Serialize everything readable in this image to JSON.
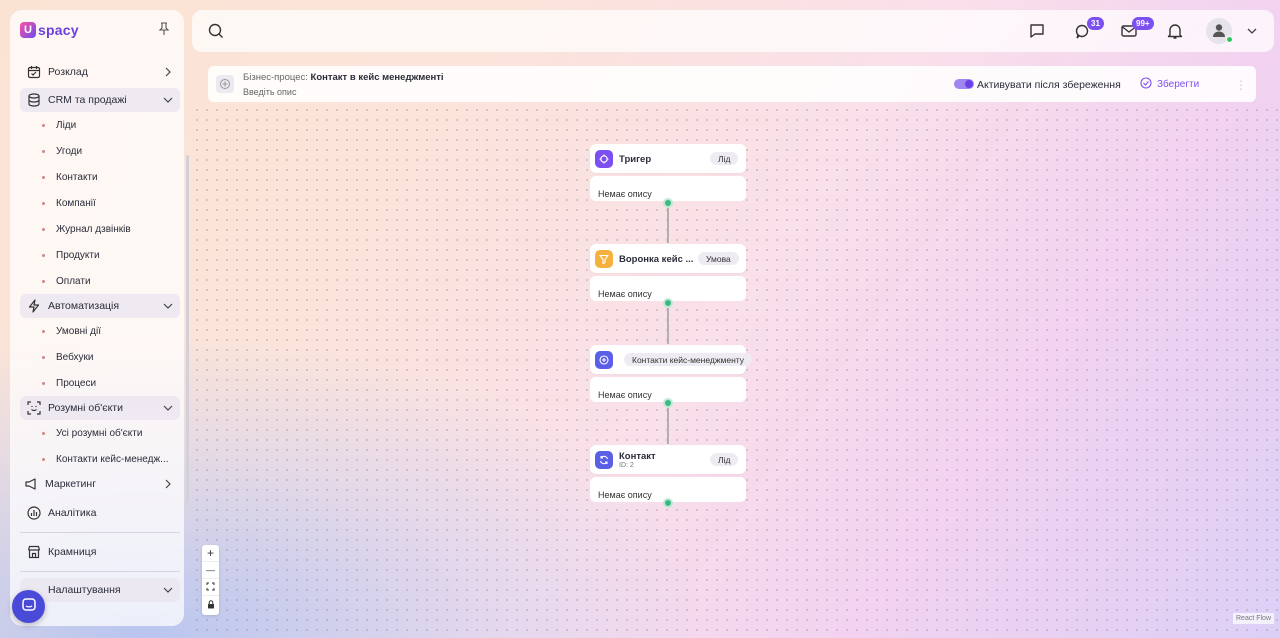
{
  "brand": {
    "logo_mark": "U",
    "logo_text": "spacy"
  },
  "sidebar": {
    "items": [
      {
        "label": "Розклад"
      },
      {
        "label": "CRM та продажі"
      },
      {
        "label": "Ліди"
      },
      {
        "label": "Угоди"
      },
      {
        "label": "Контакти"
      },
      {
        "label": "Компанії"
      },
      {
        "label": "Журнал дзвінків"
      },
      {
        "label": "Продукти"
      },
      {
        "label": "Оплати"
      },
      {
        "label": "Автоматизація"
      },
      {
        "label": "Умовні дії"
      },
      {
        "label": "Вебхуки"
      },
      {
        "label": "Процеси"
      },
      {
        "label": "Розумні об'єкти"
      },
      {
        "label": "Усі розумні об'єкти"
      },
      {
        "label": "Контакти кейс-менедж..."
      },
      {
        "label": "Маркетинг"
      },
      {
        "label": "Аналітика"
      },
      {
        "label": "Крамниця"
      },
      {
        "label": "Налаштування"
      }
    ]
  },
  "topbar": {
    "chat_badge": "31",
    "mail_badge": "99+"
  },
  "process": {
    "prefix": "Бізнес-процес: ",
    "name": "Контакт в кейс менеджменті",
    "description": "Введіть опис",
    "activate_label": "Активувати після збереження",
    "save_label": "Зберегти"
  },
  "flow": {
    "nodes": [
      {
        "title": "Тригер",
        "tag": "Лід",
        "description": "Немає опису",
        "icon": "trigger-icon",
        "color": "#7b4ff0"
      },
      {
        "title": "Воронка кейс ...",
        "tag": "Умова",
        "description": "Немає опису",
        "icon": "filter-icon",
        "color": "#f6b13c"
      },
      {
        "title": "",
        "tag": "Контакти кейс-менеджменту",
        "description": "Немає опису",
        "icon": "add-circle-icon",
        "color": "#5b5fe6"
      },
      {
        "title": "Контакт",
        "subtitle": "ID: 2",
        "tag": "Лід",
        "description": "Немає опису",
        "icon": "refresh-icon",
        "color": "#5b5fe6"
      }
    ]
  },
  "controls": {
    "zoom_in": "+",
    "zoom_out": "—"
  },
  "attribution": "React Flow"
}
